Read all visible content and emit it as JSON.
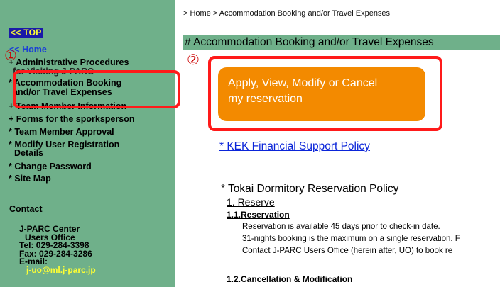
{
  "breadcrumb": "> Home > Accommodation Booking and/or Travel Expenses",
  "page_title": "# Accommodation Booking and/or Travel Expenses",
  "sidebar": {
    "top_link": "<< TOP",
    "home_link": "<< Home",
    "items": [
      "+ Administrative Procedures",
      "for Visiting J-PARC",
      "* Accommodation Booking",
      "and/or Travel Expenses",
      "+ Team Member Information",
      "+ Forms for the sporksperson",
      "* Team Member Approval",
      "* Modify User Registration",
      "Details",
      "* Change Password",
      "* Site Map"
    ],
    "contact_heading": "Contact",
    "contact_lines": [
      "J-PARC Center",
      "Users Office",
      "Tel: 029-284-3398",
      "Fax: 029-284-3286",
      "E-mail:",
      "j-uo@ml.j-parc.jp"
    ]
  },
  "annotations": {
    "marker1": "①",
    "marker2": "②"
  },
  "main": {
    "apply_button": [
      "Apply, View, Modify or Cancel",
      "my reservation"
    ],
    "kek_link": "* KEK Financial Support Policy",
    "policy_title": "* Tokai Dormitory Reservation Policy",
    "section1": "1. Reserve",
    "section1_1": "1.1.Reservation",
    "lines": [
      "Reservation is available 45 days prior to check-in date.",
      "31-nights booking is the maximum on a single reservation. F",
      "Contact J-PARC Users Office (herein after, UO) to book re"
    ],
    "section1_2": "1.2.Cancellation & Modification"
  },
  "colors": {
    "sidebar": "#6fb08a",
    "button": "#f38a00",
    "highlight": "#ff1a1a",
    "link": "#0b25d9"
  }
}
